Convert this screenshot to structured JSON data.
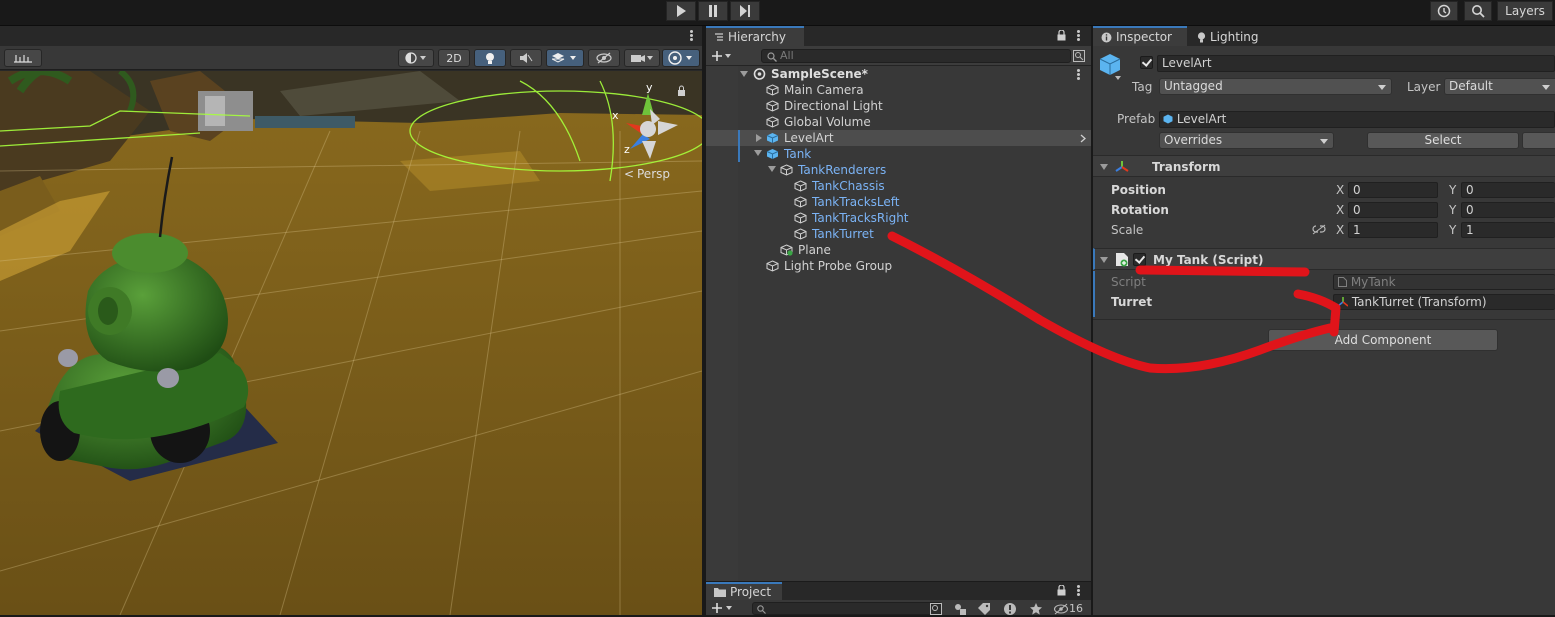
{
  "toolbar": {
    "play_icon": "play-icon",
    "pause_icon": "pause-icon",
    "step_icon": "step-icon",
    "history_icon": "history-icon",
    "search_icon": "search-icon",
    "layers_label": "Layers"
  },
  "scene": {
    "toggle_2d": "2D",
    "persp_label": "Persp",
    "gizmo_axes": {
      "x": "x",
      "y": "y",
      "z": "z"
    }
  },
  "hierarchy": {
    "tab_label": "Hierarchy",
    "search_placeholder": "All",
    "items": [
      {
        "label": "SampleScene*",
        "depth": 0,
        "kind": "scene"
      },
      {
        "label": "Main Camera",
        "depth": 1
      },
      {
        "label": "Directional Light",
        "depth": 1
      },
      {
        "label": "Global Volume",
        "depth": 1
      },
      {
        "label": "LevelArt",
        "depth": 1,
        "kind": "prefab",
        "selected": true
      },
      {
        "label": "Tank",
        "depth": 1,
        "kind": "prefab"
      },
      {
        "label": "TankRenderers",
        "depth": 2,
        "kind": "prefab-child"
      },
      {
        "label": "TankChassis",
        "depth": 3,
        "kind": "prefab-child"
      },
      {
        "label": "TankTracksLeft",
        "depth": 3,
        "kind": "prefab-child"
      },
      {
        "label": "TankTracksRight",
        "depth": 3,
        "kind": "prefab-child"
      },
      {
        "label": "TankTurret",
        "depth": 3,
        "kind": "prefab-child"
      },
      {
        "label": "Plane",
        "depth": 2,
        "kind": "added"
      },
      {
        "label": "Light Probe Group",
        "depth": 1
      }
    ]
  },
  "project": {
    "tab_label": "Project",
    "hidden_count": "16"
  },
  "inspector": {
    "tab_label": "Inspector",
    "lighting_tab_label": "Lighting",
    "object_name": "LevelArt",
    "tag_label": "Tag",
    "tag_value": "Untagged",
    "layer_label": "Layer",
    "layer_value": "Default",
    "prefab_label": "Prefab",
    "prefab_value": "LevelArt",
    "overrides_label": "Overrides",
    "select_label": "Select",
    "transform": {
      "title": "Transform",
      "position_label": "Position",
      "rotation_label": "Rotation",
      "scale_label": "Scale",
      "x_label": "X",
      "y_label": "Y",
      "position": {
        "x": "0",
        "y": "0"
      },
      "rotation": {
        "x": "0",
        "y": "0"
      },
      "scale": {
        "x": "1",
        "y": "1"
      }
    },
    "script_component": {
      "title": "My Tank (Script)",
      "script_label": "Script",
      "script_value": "MyTank",
      "turret_label": "Turret",
      "turret_value": "TankTurret (Transform)"
    },
    "add_component_label": "Add Component"
  },
  "colors": {
    "accent_blue": "#3a79bb",
    "prefab_text": "#7bb3f5",
    "annotation_red": "#e0141a"
  }
}
